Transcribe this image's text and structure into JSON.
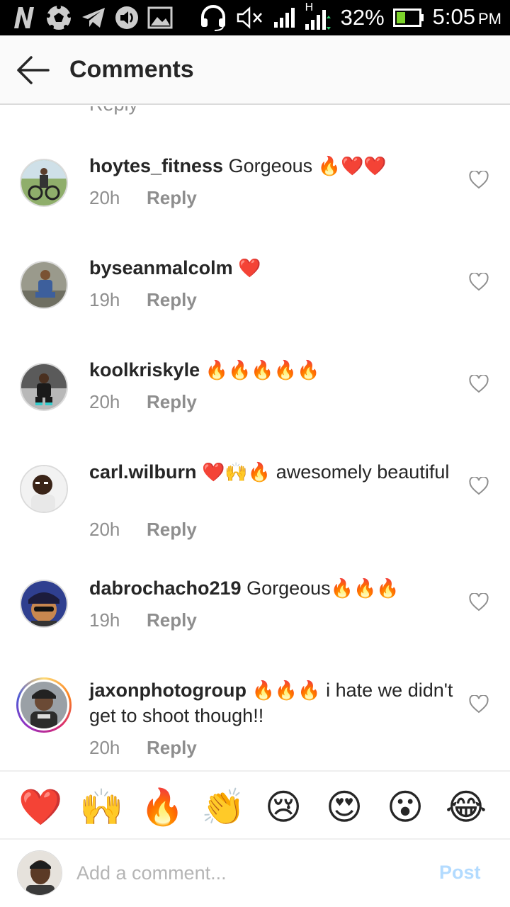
{
  "status_bar": {
    "battery": "32%",
    "time": "5:05",
    "time_suffix": "PM",
    "network": "H"
  },
  "header": {
    "title": "Comments"
  },
  "list": {
    "cut_text": "Reply"
  },
  "comments": [
    {
      "user": "hoytes_fitness",
      "text": "Gorgeous",
      "emoji": "🔥❤️❤️",
      "text_after": "",
      "time": "20h",
      "reply": "Reply"
    },
    {
      "user": "byseanmalcolm",
      "text": "",
      "emoji": "❤️",
      "text_after": "",
      "time": "19h",
      "reply": "Reply"
    },
    {
      "user": "koolkriskyle",
      "text": "",
      "emoji": "🔥🔥🔥🔥🔥",
      "text_after": "",
      "time": "20h",
      "reply": "Reply"
    },
    {
      "user": "carl.wilburn",
      "text": "",
      "emoji": "❤️🙌🔥",
      "text_after": "awesomely beautiful",
      "time": "20h",
      "reply": "Reply"
    },
    {
      "user": "dabrochacho219",
      "text": "Gorgeous",
      "emoji": "🔥🔥🔥",
      "text_after": "",
      "time": "19h",
      "reply": "Reply"
    },
    {
      "user": "jaxonphotogroup",
      "text": "",
      "emoji": "🔥🔥🔥",
      "text_after": "i hate we didn't get to shoot though!!",
      "time": "20h",
      "reply": "Reply"
    }
  ],
  "emoji_bar": [
    "❤️",
    "🙌",
    "🔥",
    "👏",
    "😢",
    "😍",
    "😮",
    "😂"
  ],
  "composer": {
    "placeholder": "Add a comment...",
    "post_label": "Post"
  },
  "colors": {
    "text": "#262626",
    "secondary": "#8e8e8e",
    "post_disabled": "#b3dbff",
    "divider": "#dbdbdb"
  }
}
